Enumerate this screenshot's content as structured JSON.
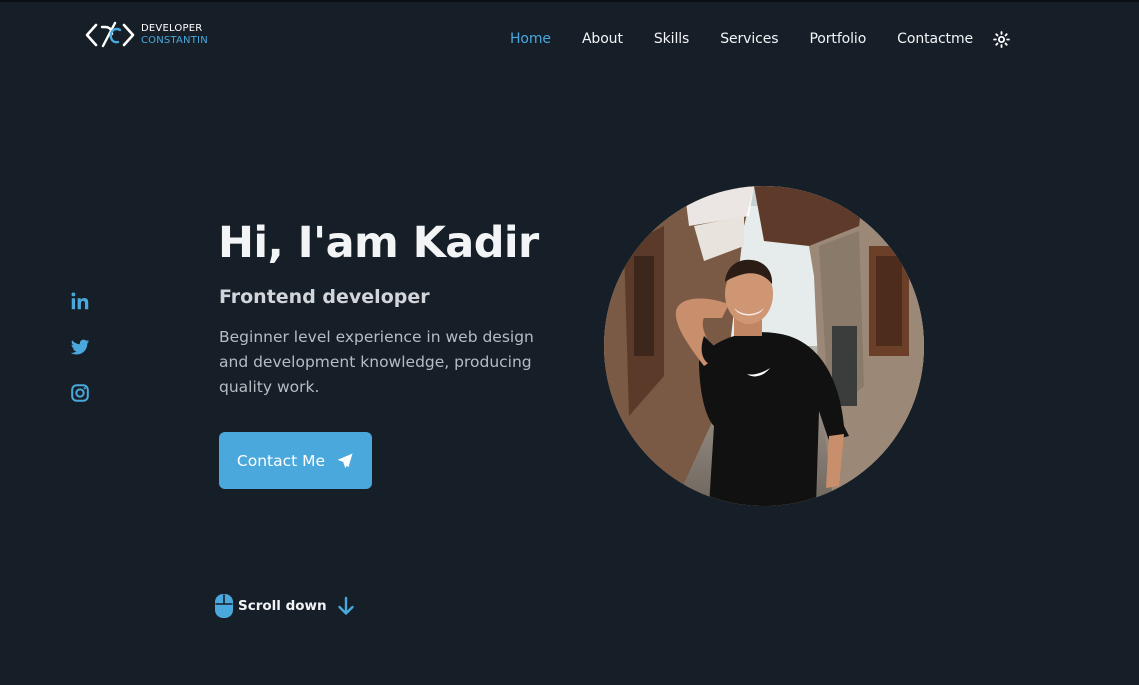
{
  "brand": {
    "line1": "DEVELOPER",
    "line2": "CONSTANTIN",
    "icon": "code-brackets-logo-icon"
  },
  "nav": {
    "items": [
      {
        "label": "Home",
        "active": true
      },
      {
        "label": "About",
        "active": false
      },
      {
        "label": "Skills",
        "active": false
      },
      {
        "label": "Services",
        "active": false
      },
      {
        "label": "Portfolio",
        "active": false
      },
      {
        "label": "Contactme",
        "active": false
      }
    ],
    "theme_icon": "sun-icon"
  },
  "social": [
    {
      "icon": "linkedin-icon"
    },
    {
      "icon": "twitter-icon"
    },
    {
      "icon": "instagram-icon"
    }
  ],
  "hero": {
    "title": "Hi, I'am Kadir",
    "subtitle": "Frontend developer",
    "description": "Beginner level experience in web design and development knowledge, producing quality work.",
    "button_label": "Contact Me",
    "button_icon": "paper-plane-icon",
    "photo": "profile-photo"
  },
  "scroll": {
    "label": "Scroll down",
    "icon_left": "mouse-icon",
    "icon_right": "arrow-down-icon"
  },
  "colors": {
    "background": "#161f28",
    "accent": "#4aa8dc",
    "text": "#f2f4f6",
    "muted": "#b7bcc2"
  }
}
